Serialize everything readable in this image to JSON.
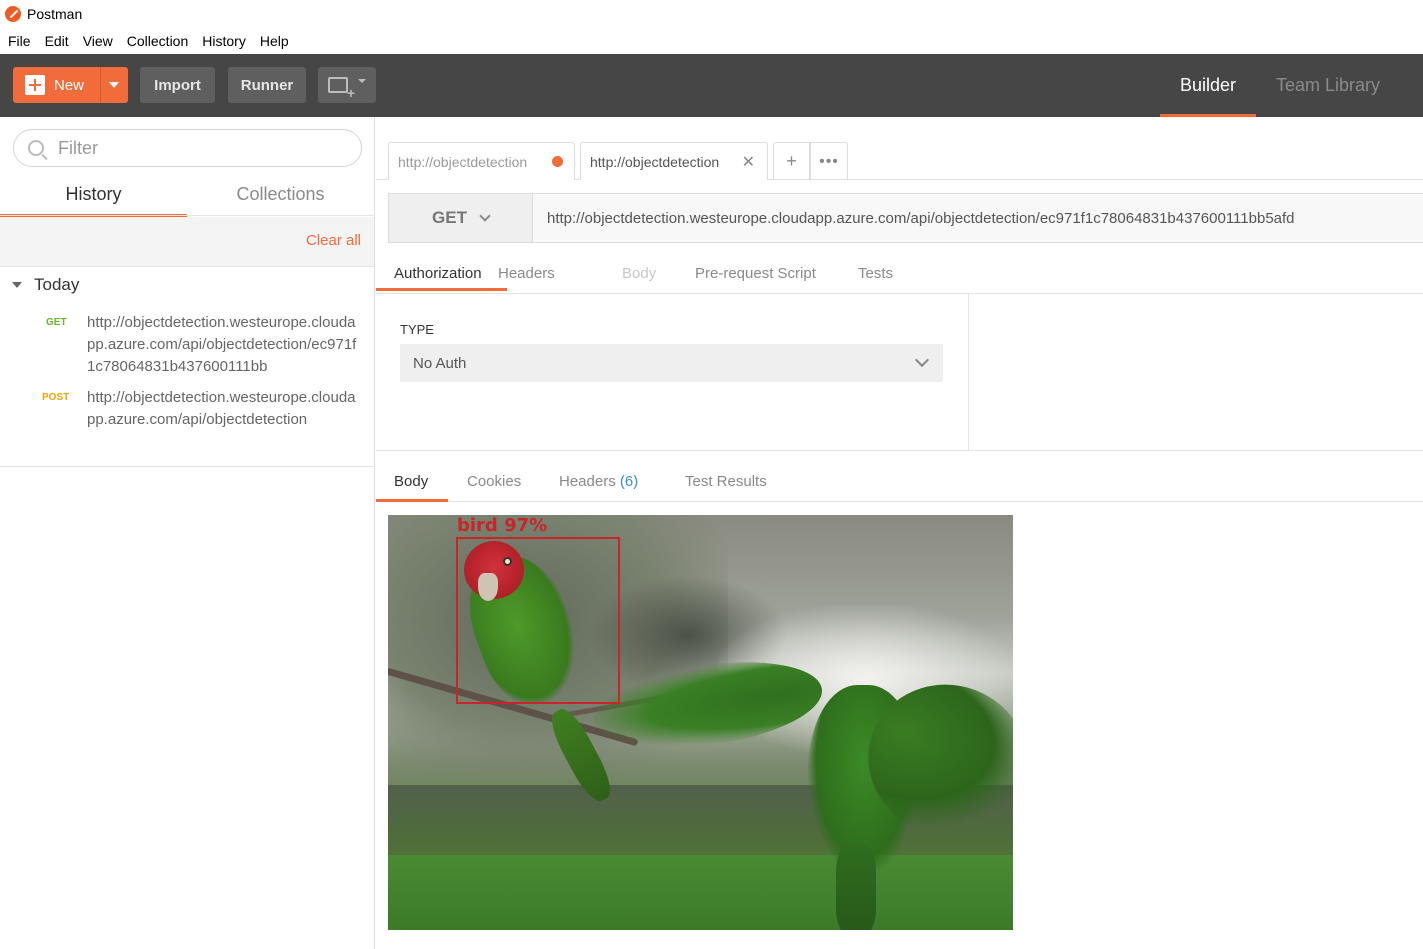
{
  "window": {
    "title": "Postman"
  },
  "menu": [
    "File",
    "Edit",
    "View",
    "Collection",
    "History",
    "Help"
  ],
  "toolbar": {
    "new_label": "New",
    "import_label": "Import",
    "runner_label": "Runner",
    "builder_label": "Builder",
    "team_library_label": "Team Library"
  },
  "sidebar": {
    "filter_placeholder": "Filter",
    "tabs": [
      "History",
      "Collections"
    ],
    "clear_all": "Clear all",
    "group": "Today",
    "items": [
      {
        "method": "GET",
        "url": "http://objectdetection.westeurope.cloudapp.azure.com/api/objectdetection/ec971f1c78064831b437600111bb"
      },
      {
        "method": "POST",
        "url": "http://objectdetection.westeurope.cloudapp.azure.com/api/objectdetection"
      }
    ]
  },
  "request_tabs": [
    {
      "label": "http://objectdetection",
      "unsaved": true
    },
    {
      "label": "http://objectdetection",
      "active": true
    }
  ],
  "request": {
    "method": "GET",
    "url": "http://objectdetection.westeurope.cloudapp.azure.com/api/objectdetection/ec971f1c78064831b437600111bb5afd"
  },
  "request_subtabs": [
    "Authorization",
    "Headers",
    "Body",
    "Pre-request Script",
    "Tests"
  ],
  "auth": {
    "type_label": "TYPE",
    "type_value": "No Auth"
  },
  "response_tabs": {
    "body": "Body",
    "cookies": "Cookies",
    "headers": "Headers",
    "headers_count": "(6)",
    "test_results": "Test Results"
  },
  "response_image": {
    "detection_label": "bird   97%"
  },
  "colors": {
    "accent": "#f26b3a",
    "toolbar_bg": "#464646",
    "get": "#6bb431",
    "post": "#f0a30a"
  }
}
